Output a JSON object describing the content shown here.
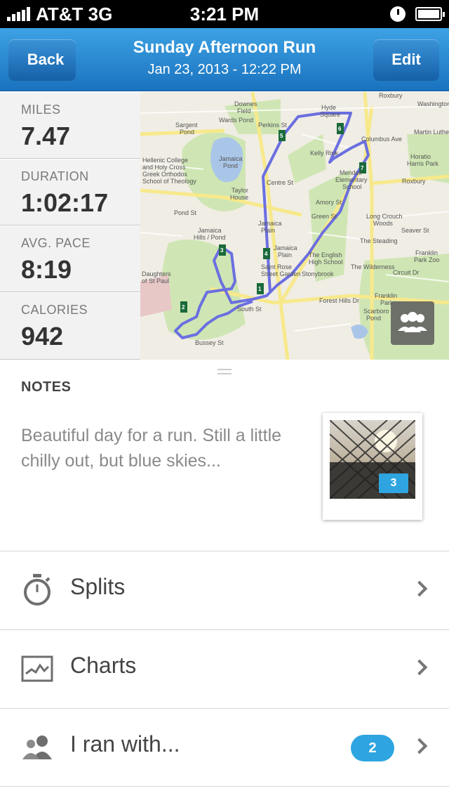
{
  "status_bar": {
    "carrier": "AT&T 3G",
    "time": "3:21 PM"
  },
  "nav": {
    "back_label": "Back",
    "edit_label": "Edit",
    "title": "Sunday Afternoon Run",
    "subtitle": "Jan 23, 2013 - 12:22 PM"
  },
  "stats": [
    {
      "label": "MILES",
      "value": "7.47"
    },
    {
      "label": "DURATION",
      "value": "1:02:17"
    },
    {
      "label": "AVG. PACE",
      "value": "8:19"
    },
    {
      "label": "CALORIES",
      "value": "942"
    }
  ],
  "map": {
    "labels": [
      "Roxbury",
      "Hyde Square",
      "Mendell Elementary School",
      "Roxbury",
      "Wards Pond",
      "Jamaica Pond",
      "Hellenic College and Holy Cross Greek Orthodox School of Theology",
      "Taylor House",
      "Jamaica Hills / Pond",
      "Jamaica Plain",
      "Jamaica Plain",
      "The English High School",
      "Saint Rose Street Garden",
      "Stonybrook",
      "Long Crouch Woods",
      "The Steading",
      "The Wilderness",
      "Franklin Park Zoo",
      "Franklin Park",
      "Horatio Harris Park",
      "Kelly Rink",
      "Downes Field",
      "Sargent Pond",
      "Daughters of St Paul",
      "Perkins St",
      "Pond St",
      "South St",
      "Bussey St",
      "Forest Hills Dr",
      "Centre St",
      "Amory St",
      "Green St",
      "Circuit Dr",
      "Seaver St",
      "Martin Luther King",
      "Washington St",
      "Columbus Ave",
      "Scarboro Pond"
    ],
    "mile_markers": [
      "1",
      "2",
      "3",
      "4",
      "5",
      "6",
      "7"
    ]
  },
  "notes": {
    "heading": "NOTES",
    "text": "Beautiful day for a run. Still a little chilly out, but blue skies...",
    "photo_count": "3"
  },
  "list": [
    {
      "label": "Splits",
      "icon": "stopwatch-icon"
    },
    {
      "label": "Charts",
      "icon": "chart-icon"
    },
    {
      "label": "I ran with...",
      "icon": "people-icon",
      "count": "2"
    }
  ],
  "colors": {
    "nav": "#1f7dc8",
    "accent": "#2ea5e0",
    "route": "#6b6fe0"
  }
}
